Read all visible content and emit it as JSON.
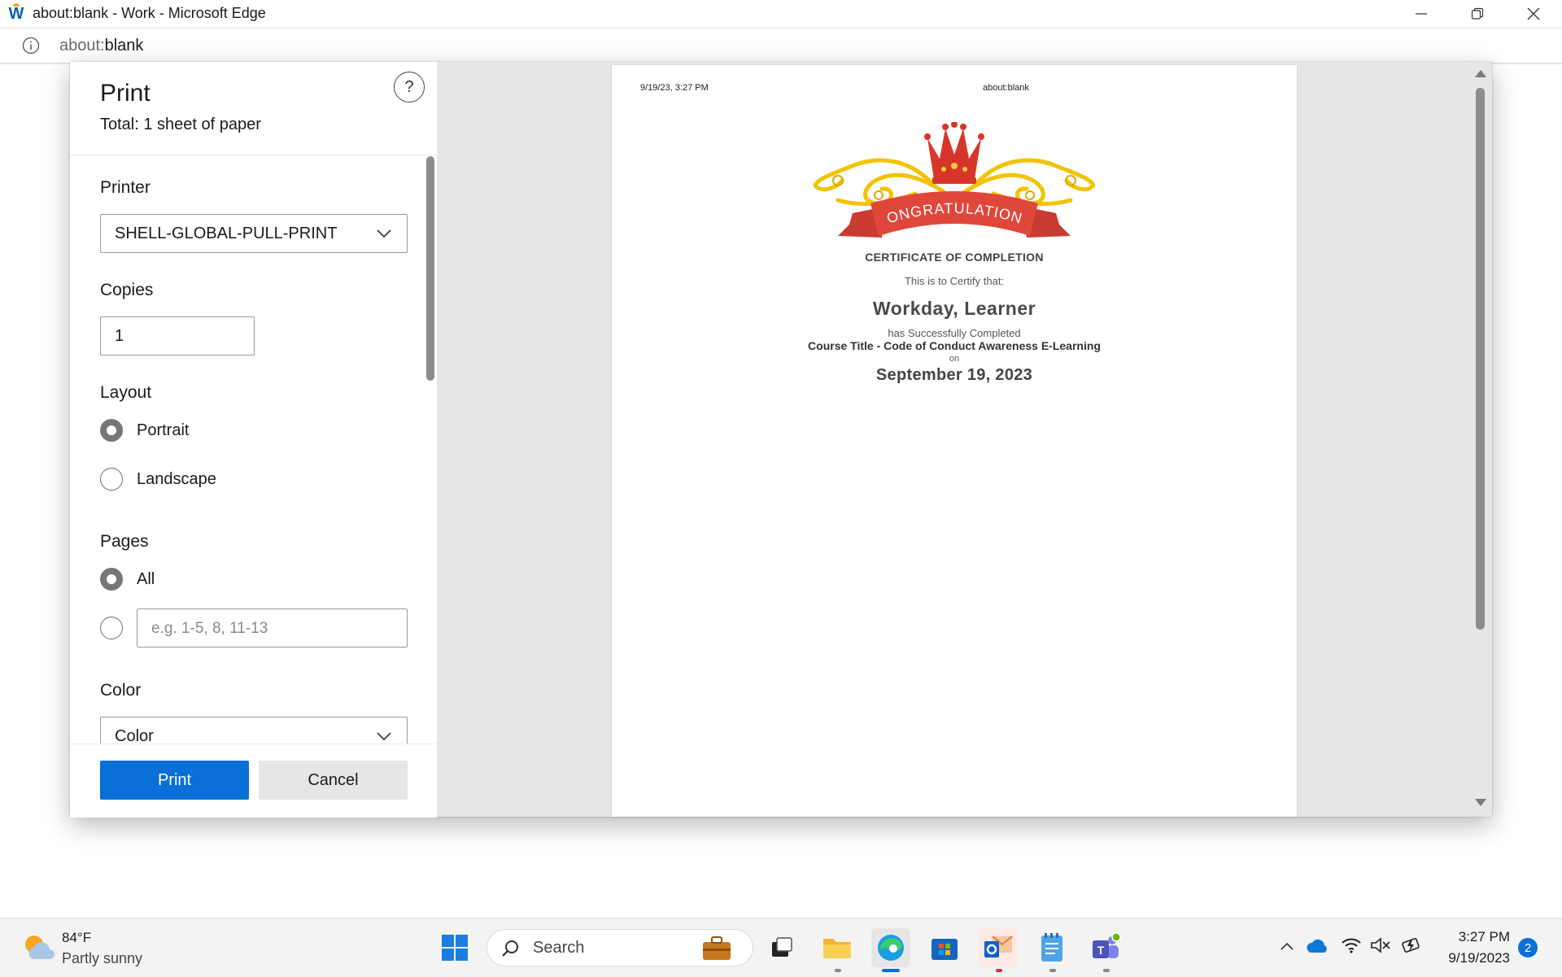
{
  "window": {
    "title": "about:blank - Work - Microsoft Edge",
    "app_icon": "workday-w-icon"
  },
  "address_bar": {
    "url_host": "about:",
    "url_path": "blank"
  },
  "print_dialog": {
    "title": "Print",
    "subtitle": "Total: 1 sheet of paper",
    "help_label": "?",
    "printer": {
      "label": "Printer",
      "value": "SHELL-GLOBAL-PULL-PRINT"
    },
    "copies": {
      "label": "Copies",
      "value": "1"
    },
    "layout": {
      "label": "Layout",
      "options": [
        "Portrait",
        "Landscape"
      ],
      "selected": "Portrait"
    },
    "pages": {
      "label": "Pages",
      "all_label": "All",
      "range_placeholder": "e.g. 1-5, 8, 11-13",
      "selected": "All"
    },
    "color": {
      "label": "Color",
      "value": "Color"
    },
    "print_button": "Print",
    "cancel_button": "Cancel"
  },
  "preview": {
    "header_left": "9/19/23, 3:27 PM",
    "header_center": "about:blank",
    "banner_text": "CONGRATULATIONS",
    "cert_title": "CERTIFICATE OF COMPLETION",
    "certify_line": "This is to Certify that:",
    "learner_name": "Workday, Learner",
    "completed_line": "has Successfully Completed",
    "course": "Course Title - Code of Conduct Awareness E-Learning",
    "on_line": "on",
    "date": "September 19, 2023"
  },
  "taskbar": {
    "weather_temp": "84°F",
    "weather_condition": "Partly sunny",
    "search_label": "Search",
    "time": "3:27 PM",
    "date": "9/19/2023",
    "notification_count": "2"
  },
  "colors": {
    "accent": "#0a6fd6",
    "banner_red": "#e0473b",
    "gold": "#f2c300"
  }
}
